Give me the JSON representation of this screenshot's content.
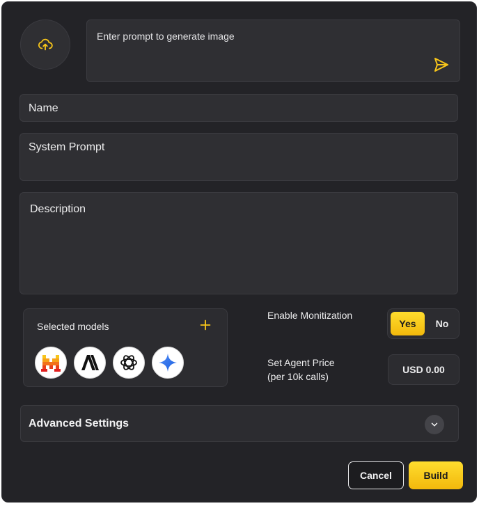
{
  "prompt": {
    "placeholder": "Enter prompt to generate image"
  },
  "fields": {
    "name": "Name",
    "system_prompt": "System Prompt",
    "description": "Description"
  },
  "models": {
    "title": "Selected models",
    "items": [
      {
        "name": "mistral",
        "icon": "mistral-icon"
      },
      {
        "name": "anthropic",
        "icon": "anthropic-icon"
      },
      {
        "name": "openai",
        "icon": "openai-icon"
      },
      {
        "name": "gemini",
        "icon": "gemini-icon"
      }
    ]
  },
  "monetization": {
    "label": "Enable Monitization",
    "yes": "Yes",
    "no": "No",
    "selected": "Yes"
  },
  "price": {
    "label_line1": "Set Agent Price",
    "label_line2": "(per 10k calls)",
    "value": "USD 0.00"
  },
  "advanced": {
    "title": "Advanced Settings"
  },
  "actions": {
    "cancel": "Cancel",
    "build": "Build"
  },
  "colors": {
    "accent": "#f7c51a",
    "background": "#232327",
    "field": "#2f2f33"
  }
}
